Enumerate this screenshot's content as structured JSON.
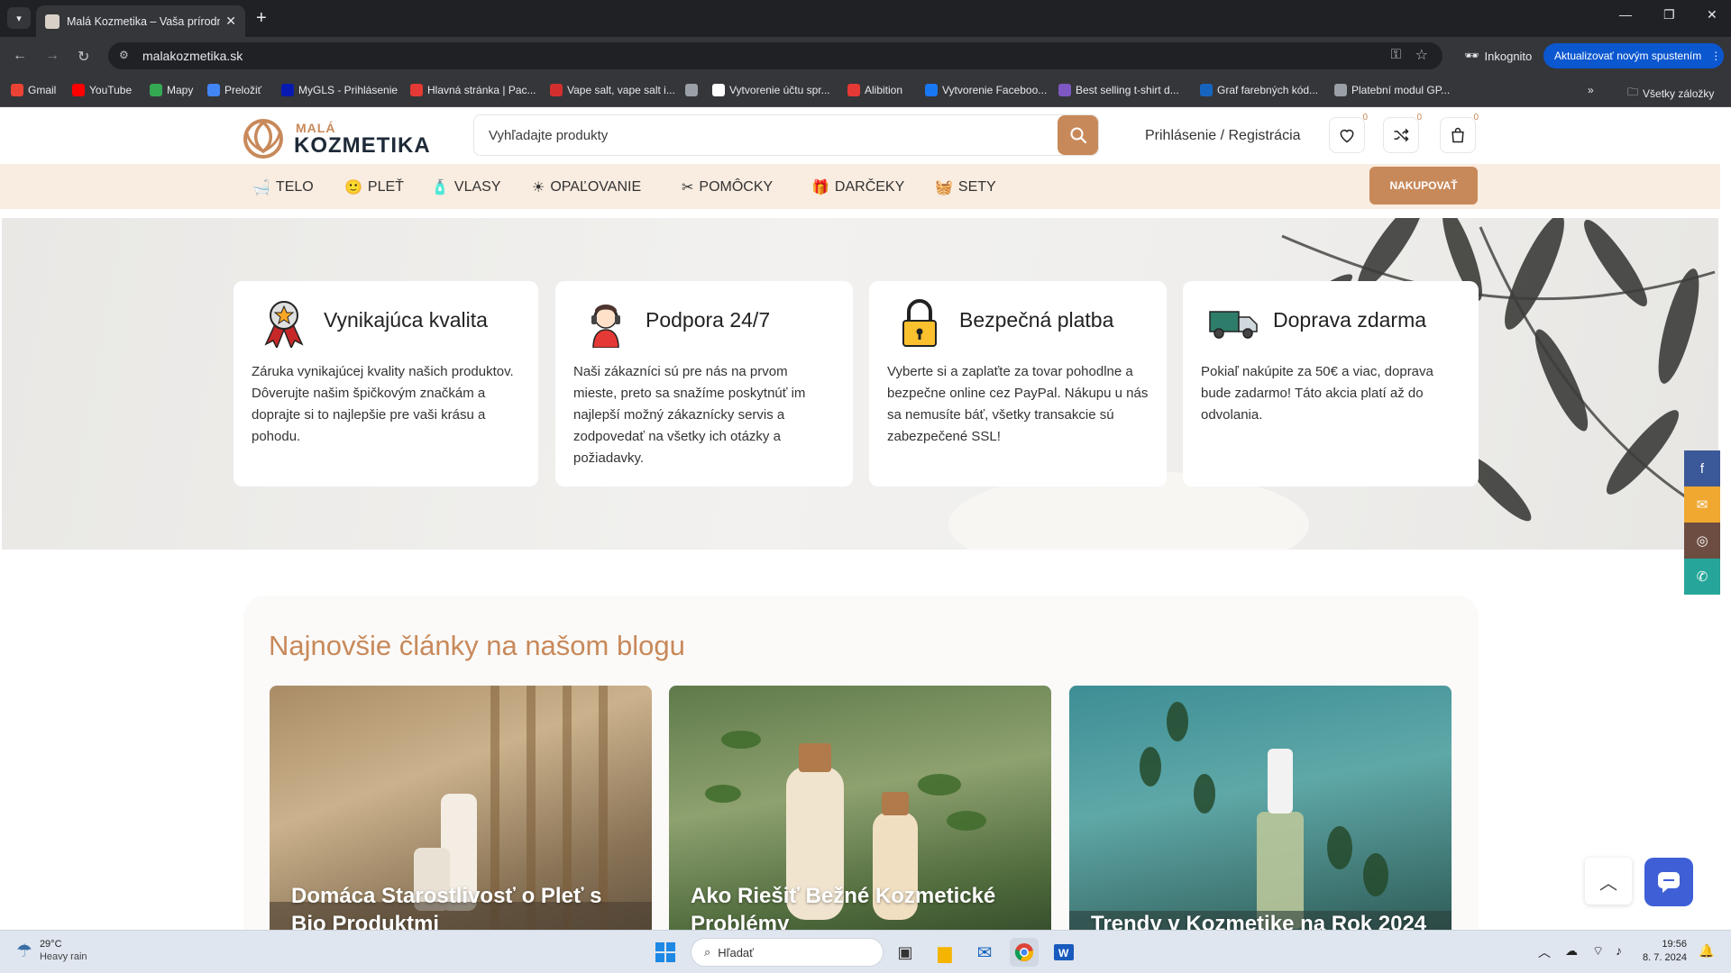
{
  "browser": {
    "tab_title": "Malá Kozmetika – Vaša prírodn...",
    "url": "malakozmetika.sk",
    "incognito_label": "Inkognito",
    "update_label": "Aktualizovať novým spustením",
    "bookmarks": [
      {
        "label": "Gmail",
        "color": "#ea4335"
      },
      {
        "label": "YouTube",
        "color": "#ff0000"
      },
      {
        "label": "Mapy",
        "color": "#34a853"
      },
      {
        "label": "Preložiť",
        "color": "#4285f4"
      },
      {
        "label": "MyGLS - Prihlásenie",
        "color": "#061ab1"
      },
      {
        "label": "Hlavná stránka | Pac...",
        "color": "#e53935"
      },
      {
        "label": "Vape salt, vape salt i...",
        "color": "#d32f2f"
      },
      {
        "label": "",
        "color": "#9aa0a6"
      },
      {
        "label": "Vytvorenie účtu spr...",
        "color": "#ffffff"
      },
      {
        "label": "Alibition",
        "color": "#e53935"
      },
      {
        "label": "Vytvorenie Faceboo...",
        "color": "#1877f2"
      },
      {
        "label": "Best selling t-shirt d...",
        "color": "#7e57c2"
      },
      {
        "label": "Graf farebných kód...",
        "color": "#1565c0"
      },
      {
        "label": "Platební modul GP...",
        "color": "#9aa0a6"
      }
    ],
    "all_bookmarks_label": "Všetky záložky"
  },
  "site": {
    "logo": {
      "top": "MALÁ",
      "bottom": "KOZMETIKA"
    },
    "search_placeholder": "Vyhľadajte produkty",
    "login_label": "Prihlásenie / Registrácia",
    "wishlist_count": "0",
    "compare_count": "0",
    "cart_count": "0",
    "accent_color": "#c8895a",
    "nav": [
      {
        "label": "TELO",
        "icon": "body-icon"
      },
      {
        "label": "PLEŤ",
        "icon": "face-icon"
      },
      {
        "label": "VLASY",
        "icon": "hair-icon"
      },
      {
        "label": "OPAĽOVANIE",
        "icon": "sun-icon"
      },
      {
        "label": "POMÔCKY",
        "icon": "tools-icon"
      },
      {
        "label": "DARČEKY",
        "icon": "gift-icon"
      },
      {
        "label": "SETY",
        "icon": "set-icon"
      }
    ],
    "shop_button": "NAKUPOVAŤ",
    "features": [
      {
        "title": "Vynikajúca kvalita",
        "icon": "award-ribbon-icon",
        "text": "Záruka vynikajúcej kvality našich produktov. Dôverujte našim špičkovým značkám a doprajte si to najlepšie pre vaši krásu a pohodu."
      },
      {
        "title": "Podpora 24/7",
        "icon": "support-agent-icon",
        "text": "Naši zákazníci sú pre nás na prvom mieste, preto sa snažíme poskytnúť im najlepší možný zákaznícky servis a zodpovedať na všetky ich otázky a požiadavky."
      },
      {
        "title": "Bezpečná platba",
        "icon": "padlock-icon",
        "text": "Vyberte si a  zaplaťte za tovar pohodlne a bezpečne online cez PayPal. Nákupu u nás sa nemusíte báť, všetky transakcie sú zabezpečené SSL!"
      },
      {
        "title": "Doprava zdarma",
        "icon": "delivery-truck-icon",
        "text": "Pokiaľ nakúpite za 50€ a viac, doprava bude zadarmo! Táto akcia platí až do odvolania."
      }
    ],
    "blog": {
      "title": "Najnovšie články na našom blogu",
      "posts": [
        {
          "title": "Domáca Starostlivosť o Pleť s Bio Produktmi"
        },
        {
          "title": "Ako Riešiť Bežné Kozmetické Problémy"
        },
        {
          "title": "Trendy v Kozmetike na Rok 2024"
        }
      ]
    }
  },
  "taskbar": {
    "temperature": "29°C",
    "weather": "Heavy rain",
    "search_placeholder": "Hľadať",
    "time": "19:56",
    "date": "8. 7. 2024"
  }
}
